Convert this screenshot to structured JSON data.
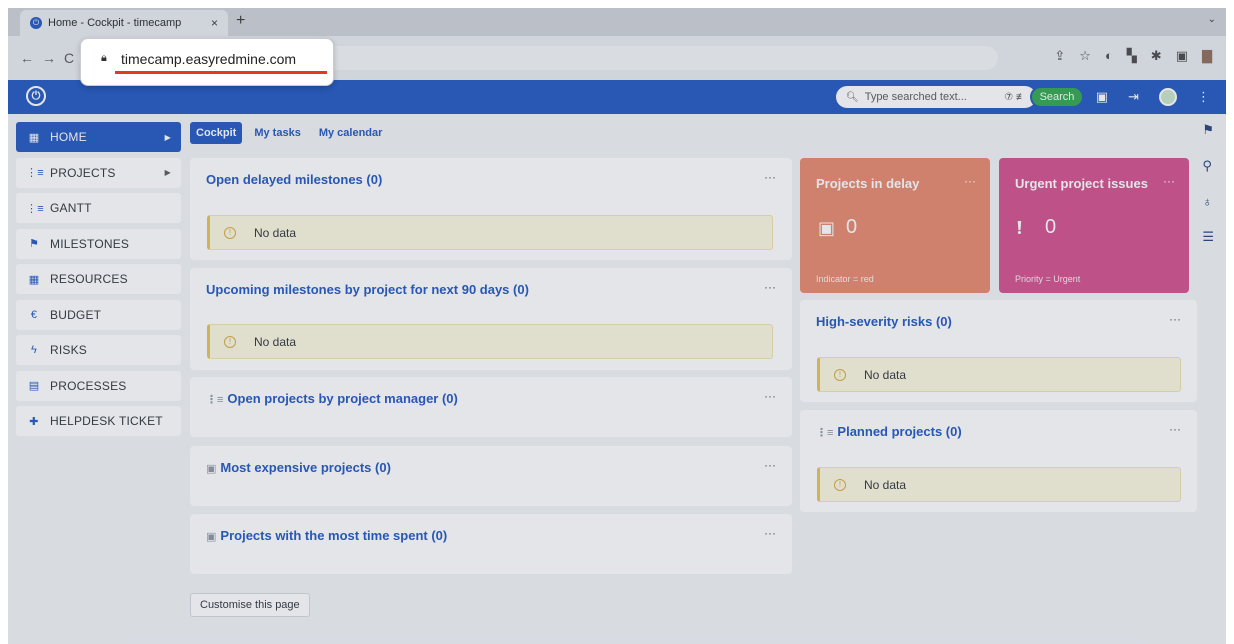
{
  "browser": {
    "tab_title": "Home - Cockpit - timecamp",
    "tab_close": "×",
    "new_tab": "+",
    "tab_menu": "⌄",
    "url": "timecamp.easyredmine.com"
  },
  "header": {
    "logo": "⏻",
    "search_placeholder": "Type searched text...",
    "search_extra": "⑦ ≢",
    "search_button": "Search"
  },
  "sidebar": {
    "items": [
      {
        "icon": "▦",
        "label": "HOME",
        "arrow": "▶"
      },
      {
        "icon": "⋮≡",
        "label": "PROJECTS",
        "arrow": "▶"
      },
      {
        "icon": "⋮≡",
        "label": "GANTT",
        "arrow": ""
      },
      {
        "icon": "⚑",
        "label": "MILESTONES",
        "arrow": ""
      },
      {
        "icon": "▦",
        "label": "RESOURCES",
        "arrow": ""
      },
      {
        "icon": "€",
        "label": "BUDGET",
        "arrow": ""
      },
      {
        "icon": "ϟ",
        "label": "RISKS",
        "arrow": ""
      },
      {
        "icon": "▤",
        "label": "PROCESSES",
        "arrow": ""
      },
      {
        "icon": "✚",
        "label": "HELPDESK TICKET",
        "arrow": ""
      }
    ]
  },
  "tabs": [
    {
      "label": "Cockpit"
    },
    {
      "label": "My tasks"
    },
    {
      "label": "My calendar"
    }
  ],
  "widgets": {
    "delayed": {
      "title": "Open delayed milestones (0)",
      "menu": "···",
      "nodata": "No data"
    },
    "upcoming": {
      "title": "Upcoming milestones by project for next 90 days (0)",
      "menu": "···",
      "nodata": "No data"
    },
    "by_manager": {
      "title": "Open projects by project manager (0)",
      "menu": "···"
    },
    "expensive": {
      "title": "Most expensive projects (0)",
      "menu": "···"
    },
    "time_spent": {
      "title": "Projects with the most time spent (0)",
      "menu": "···"
    },
    "risks": {
      "title": "High-severity risks (0)",
      "menu": "···",
      "nodata": "No data"
    },
    "planned": {
      "title": "Planned projects (0)",
      "menu": "···",
      "nodata": "No data"
    }
  },
  "kpis": {
    "delay": {
      "title": "Projects in delay",
      "menu": "···",
      "value": "0",
      "foot": "Indicator = red",
      "color": "#e8856a"
    },
    "urgent": {
      "title": "Urgent project issues",
      "menu": "···",
      "value": "0",
      "foot": "Priority = Urgent",
      "color": "#d14b8a"
    }
  },
  "customise_label": "Customise this page",
  "colors": {
    "brand": "#1b52c0",
    "search_green": "#2ca44a"
  }
}
